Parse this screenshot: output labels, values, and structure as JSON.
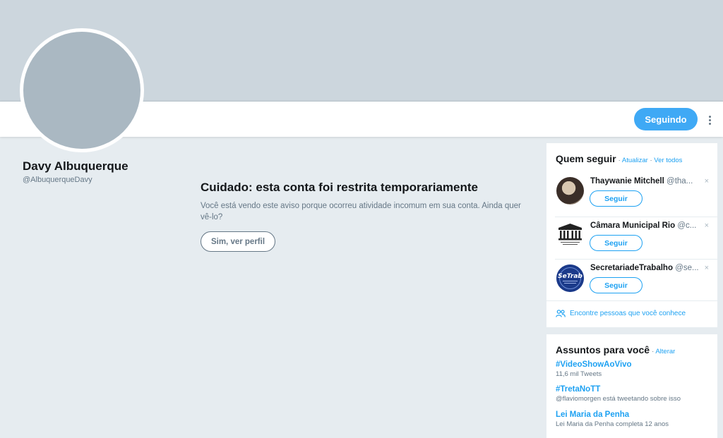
{
  "profile": {
    "name": "Davy Albuquerque",
    "handle": "@AlbuquerqueDavy",
    "follow_label": "Seguindo"
  },
  "warning": {
    "title": "Cuidado: esta conta foi restrita temporariamente",
    "text": "Você está vendo este aviso porque ocorreu atividade incomum em sua conta. Ainda quer vê-lo?",
    "button_label": "Sim, ver perfil"
  },
  "who_to_follow": {
    "title": "Quem seguir",
    "separator": " · ",
    "refresh_label": "Atualizar",
    "view_all_label": "Ver todos",
    "users": [
      {
        "name": "Thaywanie Mitchell",
        "handle": "@tha...",
        "follow_label": "Seguir",
        "close": "×"
      },
      {
        "name": "Câmara Municipal Rio",
        "handle": "@c...",
        "follow_label": "Seguir",
        "close": "×"
      },
      {
        "name": "SecretariadeTrabalho",
        "handle": "@se...",
        "follow_label": "Seguir",
        "close": "×"
      }
    ],
    "find_people_label": "Encontre pessoas que você conhece"
  },
  "trends": {
    "title": "Assuntos para você",
    "separator": " · ",
    "change_label": "Alterar",
    "items": [
      {
        "name": "#VideoShowAoVivo",
        "meta": "11,6 mil Tweets"
      },
      {
        "name": "#TretaNoTT",
        "meta": "@flaviomorgen está tweetando sobre isso"
      },
      {
        "name": "Lei Maria da Penha",
        "meta": "Lei Maria da Penha completa 12 anos"
      }
    ]
  },
  "logos": {
    "camara": "CÂMARA MUNICIPAL RIO DE JANEIRO",
    "setrab": "SeTrab"
  },
  "colors": {
    "accent": "#1da1f2",
    "follow_button": "#3fa9f5",
    "banner": "#ccd6dd",
    "background": "#e6ecf0",
    "avatar_placeholder": "#aab8c2"
  }
}
